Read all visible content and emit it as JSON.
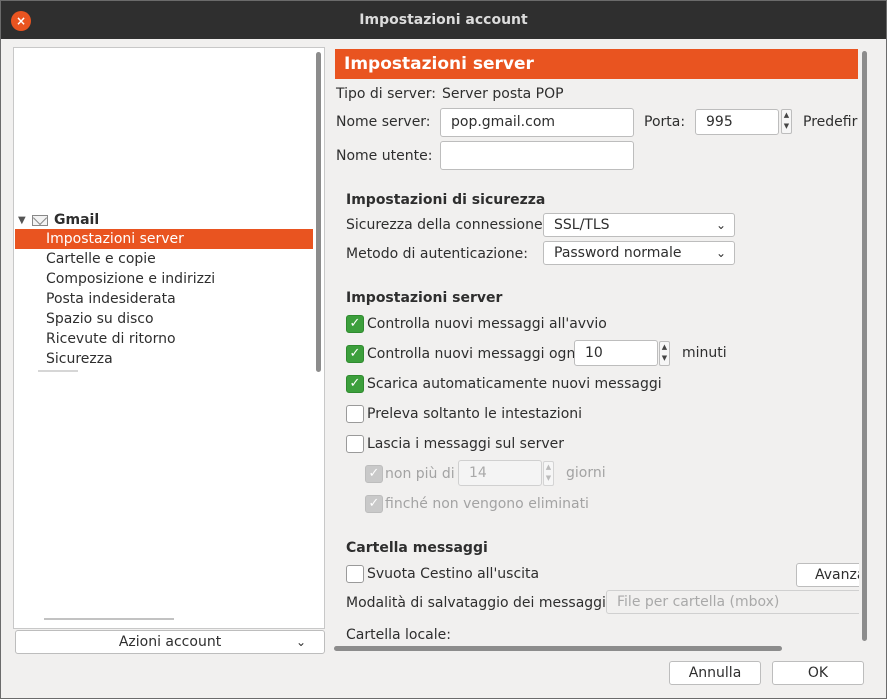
{
  "window": {
    "title": "Impostazioni account",
    "close_icon": "×"
  },
  "tree": {
    "account_name": "Gmail",
    "items": [
      {
        "label": "Impostazioni server",
        "selected": true
      },
      {
        "label": "Cartelle e copie"
      },
      {
        "label": "Composizione e indirizzi"
      },
      {
        "label": "Posta indesiderata"
      },
      {
        "label": "Spazio su disco"
      },
      {
        "label": "Ricevute di ritorno"
      },
      {
        "label": "Sicurezza"
      }
    ],
    "actions_label": "Azioni account"
  },
  "server_settings": {
    "header": "Impostazioni server",
    "server_type_label": "Tipo di server:",
    "server_type_value": "Server posta POP",
    "server_name_label": "Nome server:",
    "server_name_value": "pop.gmail.com",
    "port_label": "Porta:",
    "port_value": "995",
    "default_label": "Predefir",
    "username_label": "Nome utente:",
    "username_value": ""
  },
  "security": {
    "section_title": "Impostazioni di sicurezza",
    "connection_label": "Sicurezza della connessione:",
    "connection_value": "SSL/TLS",
    "auth_label": "Metodo di autenticazione:",
    "auth_value": "Password normale"
  },
  "server_options": {
    "section_title": "Impostazioni server",
    "check_on_startup": {
      "label": "Controlla nuovi messaggi all'avvio",
      "checked": true
    },
    "check_every": {
      "label": "Controlla nuovi messaggi ogni",
      "checked": true,
      "value": "10",
      "unit": "minuti"
    },
    "auto_download": {
      "label": "Scarica automaticamente nuovi messaggi",
      "checked": true
    },
    "headers_only": {
      "label": "Preleva soltanto le intestazioni",
      "checked": false
    },
    "leave_on_server": {
      "label": "Lascia i messaggi sul server",
      "checked": false
    },
    "max_days": {
      "label": "non più di",
      "value": "14",
      "unit": "giorni",
      "checked": true,
      "disabled": true
    },
    "until_deleted": {
      "label": "finché non vengono eliminati",
      "checked": true,
      "disabled": true
    }
  },
  "folder": {
    "section_title": "Cartella messaggi",
    "empty_trash": {
      "label": "Svuota Cestino all'uscita",
      "checked": false
    },
    "advanced_label": "Avanza",
    "storage_label": "Modalità di salvataggio dei messaggi:",
    "storage_value": "File per cartella (mbox)",
    "local_folder_label": "Cartella locale:"
  },
  "footer": {
    "cancel_label": "Annulla",
    "ok_label": "OK"
  },
  "colors": {
    "accent": "#e95420",
    "checkbox_on": "#3c9f3c",
    "titlebar": "#2f2f2f"
  }
}
